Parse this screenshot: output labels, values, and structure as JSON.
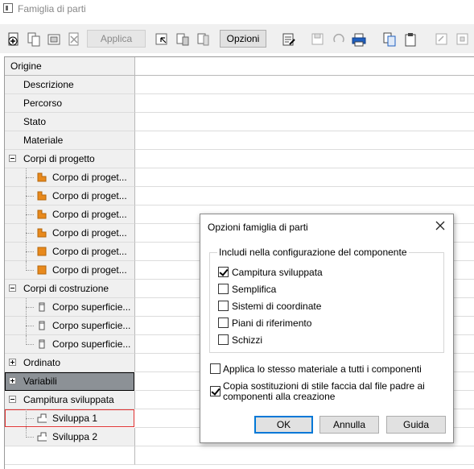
{
  "window": {
    "title": "Famiglia di parti"
  },
  "toolbar": {
    "apply_label": "Applica",
    "options_label": "Opzioni"
  },
  "grid": {
    "header": "Origine",
    "rows": [
      {
        "label": "Descrizione"
      },
      {
        "label": "Percorso"
      },
      {
        "label": "Stato"
      },
      {
        "label": "Materiale"
      },
      {
        "label": "Corpi di progetto"
      },
      {
        "label": "Corpo di proget..."
      },
      {
        "label": "Corpo di proget..."
      },
      {
        "label": "Corpo di proget..."
      },
      {
        "label": "Corpo di proget..."
      },
      {
        "label": "Corpo di proget..."
      },
      {
        "label": "Corpo di proget..."
      },
      {
        "label": "Corpi di costruzione"
      },
      {
        "label": "Corpo superficie..."
      },
      {
        "label": "Corpo superficie..."
      },
      {
        "label": "Corpo superficie..."
      },
      {
        "label": "Ordinato"
      },
      {
        "label": "Variabili"
      },
      {
        "label": "Campitura sviluppata"
      },
      {
        "label": "Sviluppa 1"
      },
      {
        "label": "Sviluppa 2"
      }
    ]
  },
  "dialog": {
    "title": "Opzioni famiglia di parti",
    "group_title": "Includi nella configurazione del componente",
    "options": [
      {
        "label": "Campitura sviluppata",
        "checked": true
      },
      {
        "label": "Semplifica",
        "checked": false
      },
      {
        "label": "Sistemi di coordinate",
        "checked": false
      },
      {
        "label": "Piani di riferimento",
        "checked": false
      },
      {
        "label": "Schizzi",
        "checked": false
      }
    ],
    "apply_material": {
      "label": "Applica lo stesso materiale a tutti i componenti",
      "checked": false
    },
    "copy_overrides": {
      "label_line1": "Copia sostituzioni di stile faccia dal file padre ai",
      "label_line2": "componenti alla creazione",
      "checked": true
    },
    "ok_label": "OK",
    "cancel_label": "Annulla",
    "help_label": "Guida"
  },
  "colors": {
    "accent": "#0078d7",
    "body_orange": "#e8891c",
    "selection_red": "#e03030",
    "variabili_bg": "#8c9196"
  }
}
